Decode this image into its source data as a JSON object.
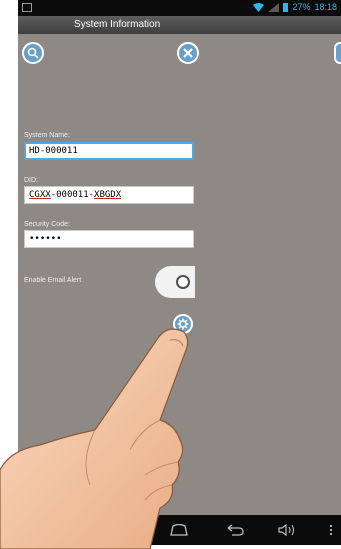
{
  "status_bar": {
    "battery_text": "27%",
    "time": "18:18",
    "accent_color": "#34b5e5"
  },
  "title_bar": {
    "title": "System Information"
  },
  "toolbar": {
    "search_icon": "search-icon",
    "close_icon": "close-icon"
  },
  "form": {
    "system_name": {
      "label": "System Name:",
      "value": "HD-000011"
    },
    "did": {
      "label": "DID:",
      "value_part1": "CGXX",
      "value_part2": "-000011-",
      "value_part3": "XBGDX"
    },
    "security_code": {
      "label": "Security Code:",
      "value": "••••••"
    },
    "email_alert": {
      "label": "Enable Email Alert",
      "enabled": false
    }
  },
  "nav_bar": {
    "icons": [
      "home-icon",
      "back-icon",
      "volume-icon",
      "menu-icon"
    ]
  },
  "colors": {
    "background": "#8e8985",
    "button_blue": "#6a9fc8",
    "focus_border": "#5aa5d8"
  }
}
